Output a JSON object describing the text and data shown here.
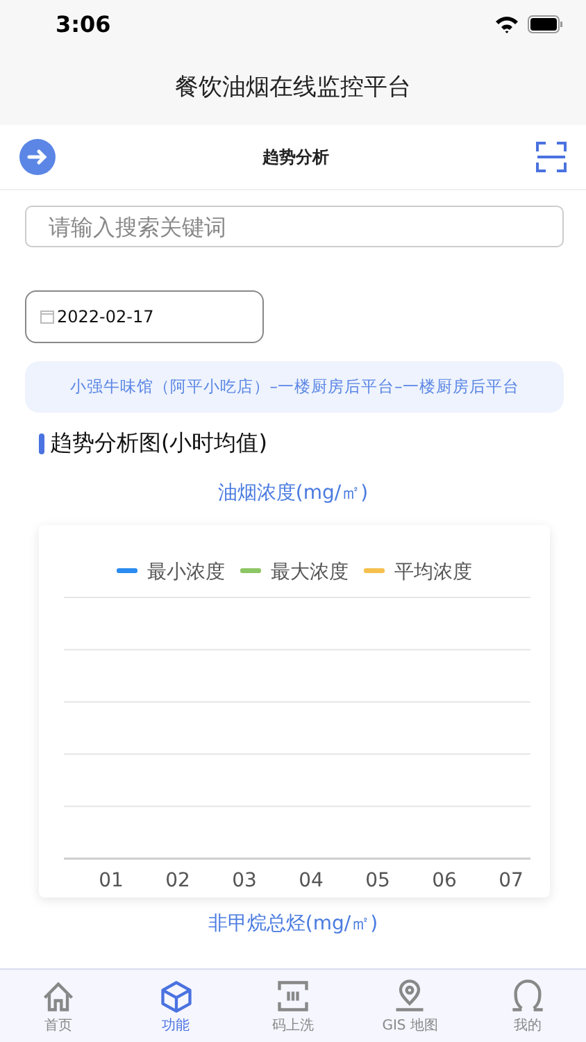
{
  "status_bar": {
    "time": "3:06"
  },
  "app_title": "餐饮油烟在线监控平台",
  "header": {
    "title": "趋势分析"
  },
  "search": {
    "placeholder": "请输入搜索关键词"
  },
  "date_field": {
    "value": "2022-02-17"
  },
  "location": "小强牛味馆（阿平小吃店）–一楼厨房后平台–一楼厨房后平台",
  "section_title": "趋势分析图(小时均值)",
  "charts": [
    {
      "title": "油烟浓度(mg/㎡)",
      "x_labels": [
        "01",
        "02",
        "03",
        "04",
        "05",
        "06",
        "07"
      ],
      "legend": [
        {
          "name": "最小浓度",
          "color": "#2a8cf0"
        },
        {
          "name": "最大浓度",
          "color": "#8dc665"
        },
        {
          "name": "平均浓度",
          "color": "#f5c04e"
        }
      ]
    }
  ],
  "next_chart_title": "非甲烷总烃(mg/㎡)",
  "tabs": [
    {
      "label": "首页",
      "kind": "home",
      "selected": false
    },
    {
      "label": "功能",
      "kind": "cube",
      "selected": true
    },
    {
      "label": "码上洗",
      "kind": "scan",
      "selected": false
    },
    {
      "label": "GIS 地图",
      "kind": "map",
      "selected": false
    },
    {
      "label": "我的",
      "kind": "person",
      "selected": false
    }
  ]
}
